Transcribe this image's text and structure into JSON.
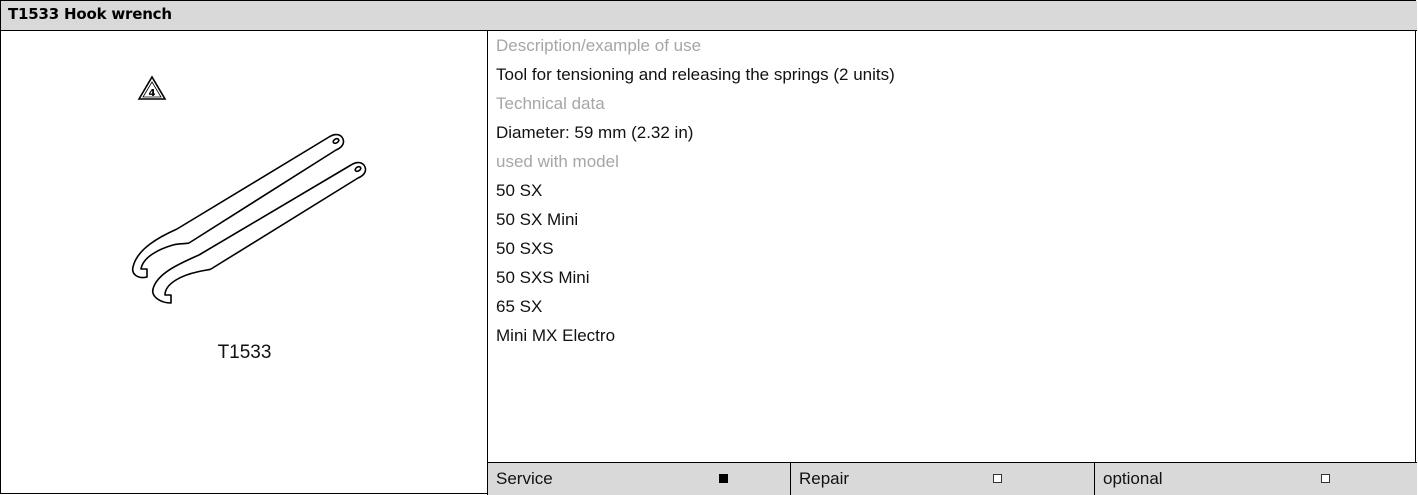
{
  "header": {
    "title": "T1533 Hook wrench"
  },
  "tool": {
    "caption": "T1533",
    "warning_icon_number": "4"
  },
  "details": {
    "description_label": "Description/example of use",
    "description_value": "Tool for tensioning and releasing the springs (2 units)",
    "technical_label": "Technical data",
    "technical_value": "Diameter: 59 mm (2.32 in)",
    "models_label": "used with model",
    "models": [
      "50 SX",
      "50 SX Mini",
      "50 SXS",
      "50 SXS Mini",
      "65 SX",
      "Mini MX Electro"
    ]
  },
  "footer": {
    "service_label": "Service",
    "service_checked": true,
    "repair_label": "Repair",
    "repair_checked": false,
    "optional_label": "optional",
    "optional_checked": false
  }
}
